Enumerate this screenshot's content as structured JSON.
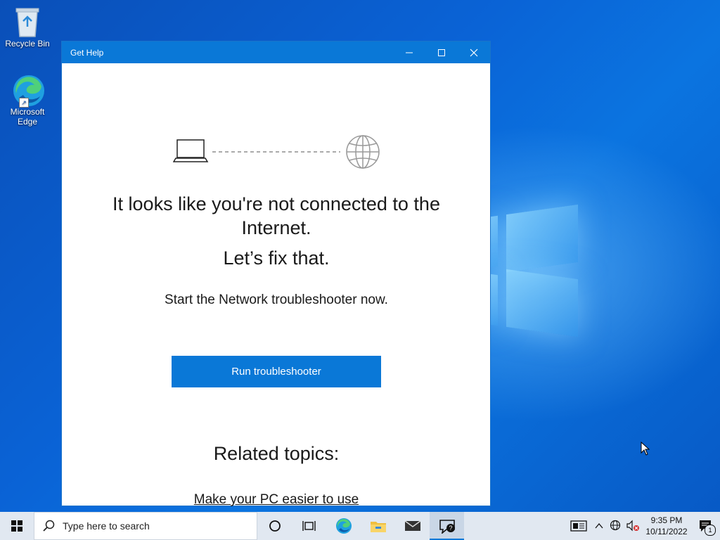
{
  "desktop": {
    "icons": [
      {
        "label": "Recycle Bin"
      },
      {
        "label": "Microsoft Edge"
      }
    ]
  },
  "window": {
    "title": "Get Help",
    "minimize_label": "—",
    "maximize_label": "☐",
    "close_label": "✕"
  },
  "main": {
    "headline": "It looks like you're not connected to the Internet.",
    "subheadline": "Let’s fix that.",
    "description": "Start the Network troubleshooter now.",
    "run_button": "Run troubleshooter",
    "related_title": "Related topics:",
    "related_link": "Make your PC easier to use"
  },
  "taskbar": {
    "search_placeholder": "Type here to search",
    "time": "9:35 PM",
    "date": "10/11/2022",
    "notification_count": "1"
  },
  "colors": {
    "accent": "#0a78d7",
    "taskbar": "#e1e8f1"
  }
}
